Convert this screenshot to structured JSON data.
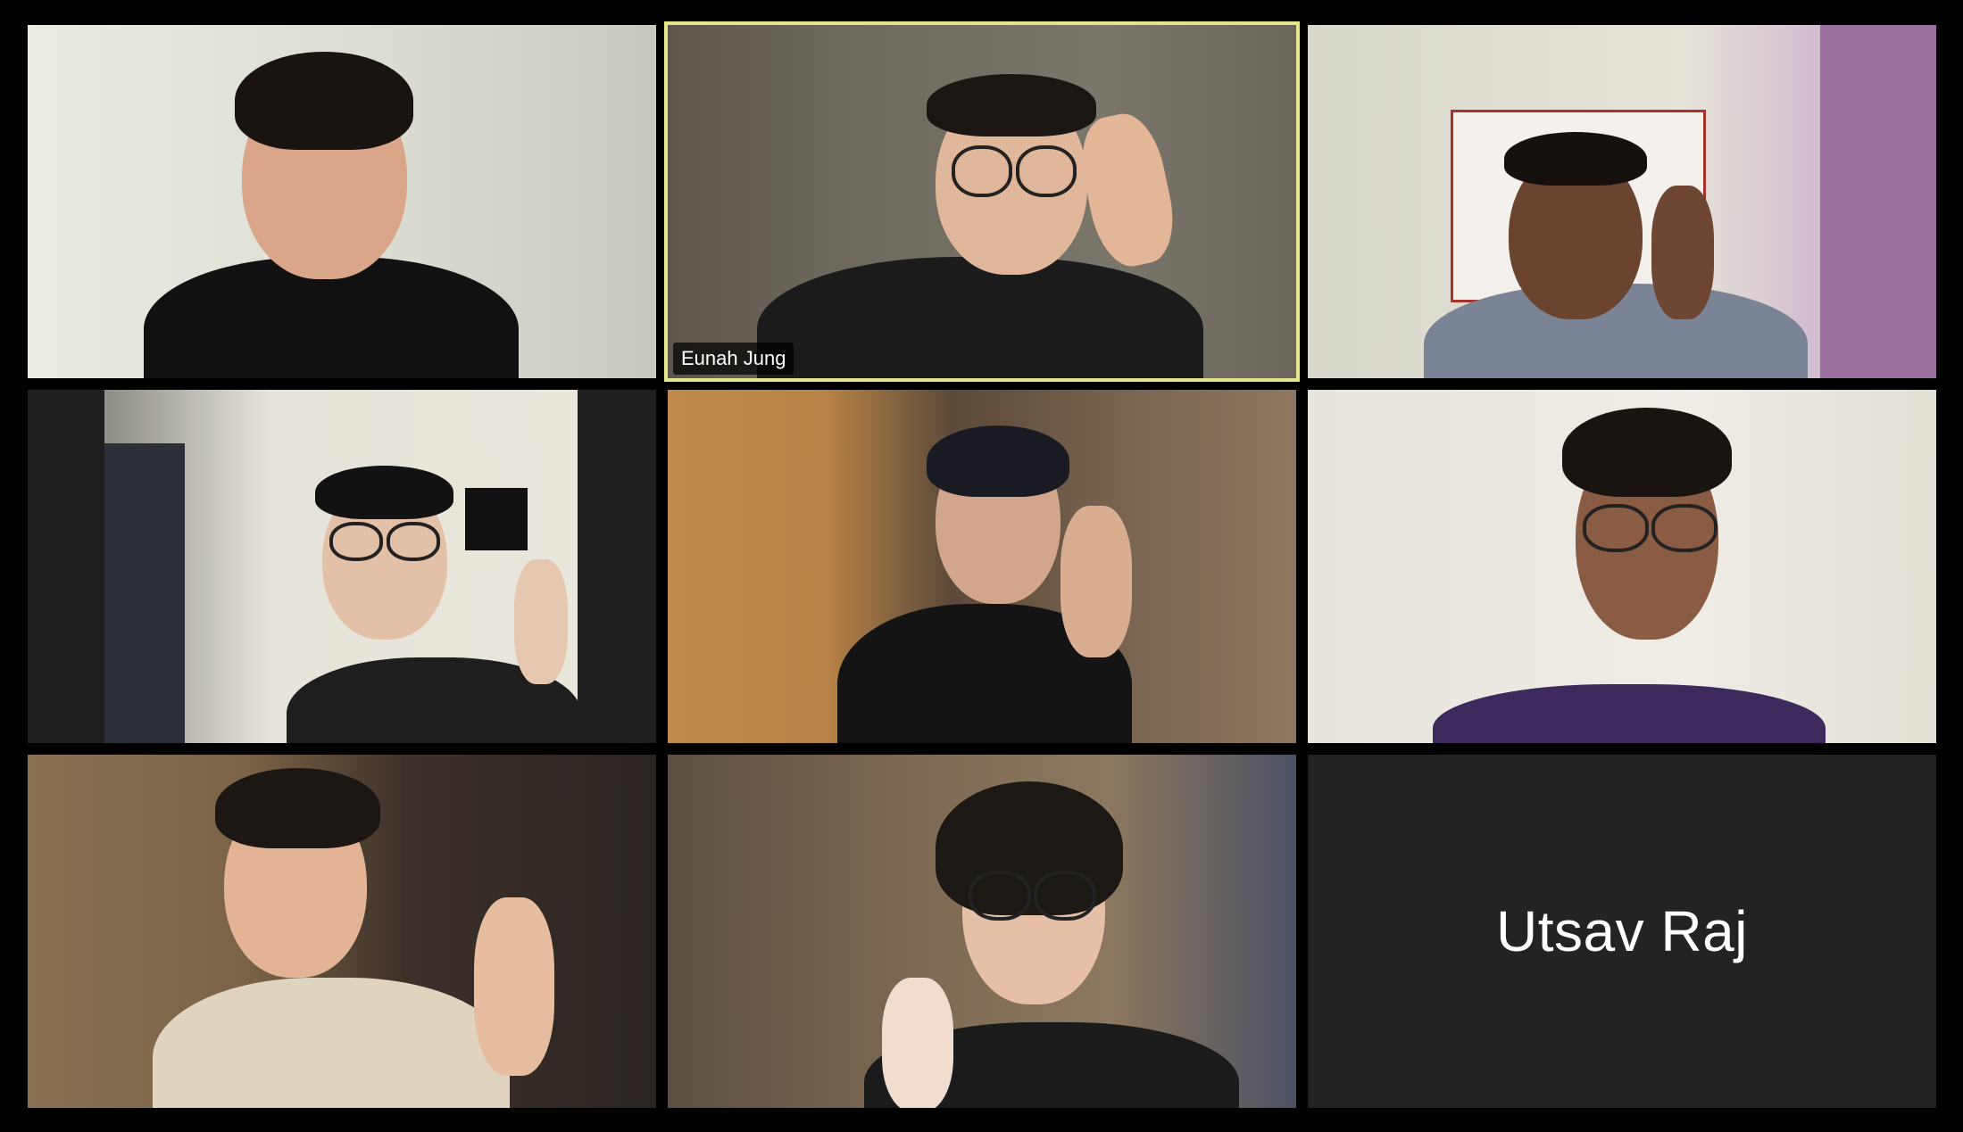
{
  "participants": [
    {
      "id": "p1",
      "name": ""
    },
    {
      "id": "p2",
      "name": "Eunah Jung",
      "active_speaker": true
    },
    {
      "id": "p3",
      "name": ""
    },
    {
      "id": "p4",
      "name": ""
    },
    {
      "id": "p5",
      "name": ""
    },
    {
      "id": "p6",
      "name": ""
    },
    {
      "id": "p7",
      "name": ""
    },
    {
      "id": "p8",
      "name": ""
    },
    {
      "id": "p9",
      "name": "Utsav Raj",
      "video_off": true
    }
  ],
  "colors": {
    "active_speaker_border": "#e3e68a",
    "tile_background": "#232323",
    "app_background": "#000000"
  }
}
